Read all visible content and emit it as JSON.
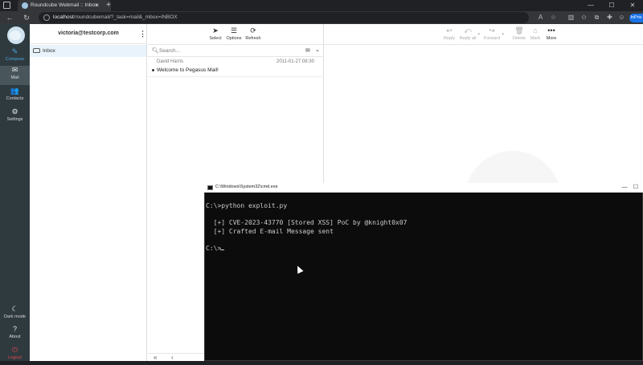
{
  "browser": {
    "tab_title": "Roundcube Webmail :: Inbox",
    "tab_close": "×",
    "new_tab": "+",
    "url_host": "localhost",
    "url_path": "/roundcubemail/?_task=mail&_mbox=INBOX",
    "profile_label": "InPriv",
    "window_controls": [
      "—",
      "☐",
      "✕"
    ]
  },
  "rail": {
    "compose": "Compose",
    "mail": "Mail",
    "contacts": "Contacts",
    "settings": "Settings",
    "dark_mode": "Dark mode",
    "about": "About",
    "logout": "Logout"
  },
  "folders": {
    "account": "victoria@testcorp.com",
    "menu_glyph": "⋮",
    "items": [
      {
        "label": "Inbox"
      }
    ]
  },
  "list_toolbar": {
    "select": "Select",
    "options": "Options",
    "refresh": "Refresh"
  },
  "search": {
    "placeholder": "Search..."
  },
  "messages": [
    {
      "from": "David Harris",
      "date": "2011-01-27 08:30",
      "subject": "Welcome to Pegasus Mail!"
    }
  ],
  "pager": {
    "first": "«",
    "prev": "‹"
  },
  "read_toolbar": {
    "reply": "Reply",
    "reply_all": "Reply all",
    "forward": "Forward",
    "delete": "Delete",
    "mark": "Mark",
    "more": "More"
  },
  "cmd": {
    "title": "C:\\Windows\\System32\\cmd.exe",
    "lines": [
      "C:\\>python exploit.py",
      "  [+] CVE-2023-43770 [Stored XSS] PoC by @knight0x07",
      "  [+] Crafted E-mail Message sent",
      "C:\\>"
    ]
  },
  "icons": {
    "accent": "#4aa6df",
    "rail_bg": "#2f3a3f",
    "logout_color": "#e3494d"
  }
}
